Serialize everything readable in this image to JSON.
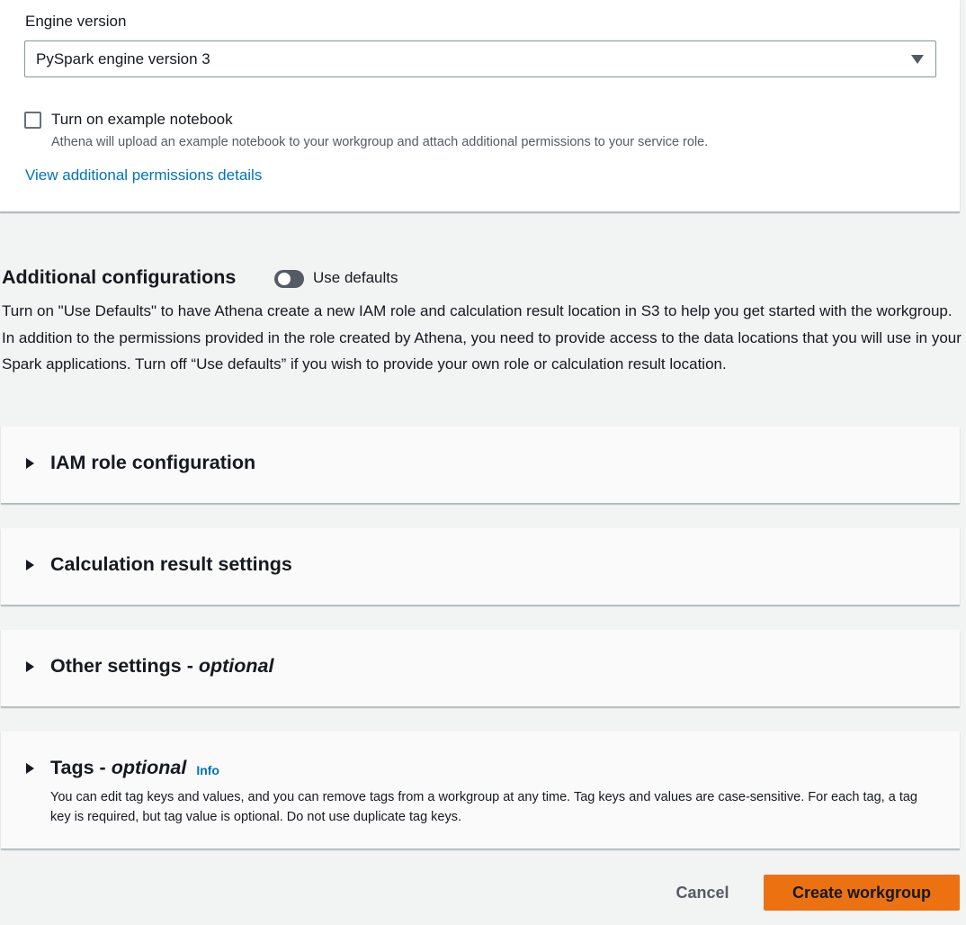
{
  "engine": {
    "label": "Engine version",
    "selected": "PySpark engine version 3"
  },
  "example_notebook": {
    "label": "Turn on example notebook",
    "description": "Athena will upload an example notebook to your workgroup and attach additional permissions to your service role.",
    "checked": false
  },
  "permissions_link": "View additional permissions details",
  "additional": {
    "heading": "Additional configurations",
    "toggle_label": "Use defaults",
    "toggle_on": false,
    "description": "Turn on \"Use Defaults\" to have Athena create a new IAM role and calculation result location in S3 to help you get started with the workgroup. In addition to the permissions provided in the role created by Athena, you need to provide access to the data locations that you will use in your Spark applications. Turn off “Use defaults” if you wish to provide your own role or calculation result location."
  },
  "sections": {
    "iam": {
      "title": "IAM role configuration"
    },
    "calc": {
      "title": "Calculation result settings"
    },
    "other": {
      "title": "Other settings - ",
      "title_em": "optional"
    },
    "tags": {
      "title": "Tags - ",
      "title_em": "optional",
      "info": "Info",
      "description": "You can edit tag keys and values, and you can remove tags from a workgroup at any time. Tag keys and values are case-sensitive. For each tag, a tag key is required, but tag value is optional. Do not use duplicate tag keys."
    }
  },
  "actions": {
    "cancel": "Cancel",
    "create": "Create workgroup"
  },
  "colors": {
    "primary_button": "#ec7211",
    "link": "#0073bb",
    "page_background": "#f2f3f3"
  }
}
